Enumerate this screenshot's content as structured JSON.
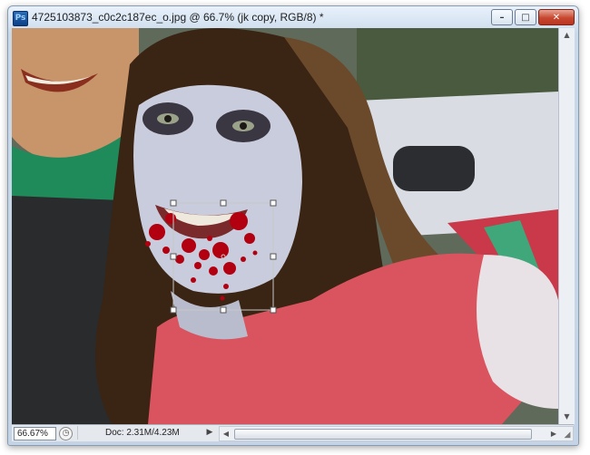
{
  "app": {
    "logo_text": "Ps"
  },
  "document": {
    "title": "4725103873_c0c2c187ec_o.jpg @ 66.7% (jk copy, RGB/8) *"
  },
  "window_controls": {
    "minimize": "–",
    "maximize": "□",
    "close": "✕"
  },
  "status": {
    "zoom": "66.67%",
    "doc_size": "Doc: 2.31M/4.23M",
    "menu_arrow": "▶"
  },
  "scroll": {
    "up": "▲",
    "down": "▼",
    "left": "◀",
    "right": "▶"
  },
  "canvas": {
    "content": "Photo of two people; the girl's face is painted pale with dark eye makeup and red blood splatter around her mouth, with a free-transform bounding box around the blood layer.",
    "palette": {
      "face_pale": "#c9ccdc",
      "hair": "#3a2414",
      "shirt": "#d9545e",
      "blood": "#b30010",
      "eye_shadow": "#3a3642",
      "left_skin": "#c8946a",
      "scarf": "#1f8a5a",
      "background_car": "#d9dde3",
      "transform_box": "#c8c8c8"
    }
  }
}
